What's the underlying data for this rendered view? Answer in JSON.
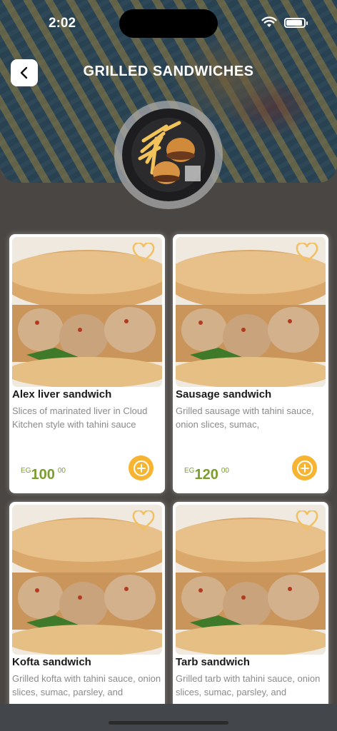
{
  "status_bar": {
    "time": "2:02"
  },
  "header": {
    "title": "GRILLED SANDWICHES"
  },
  "icons": {
    "back": "chevron-left-icon",
    "favorite": "heart-outline-icon",
    "add": "plus-circle-icon"
  },
  "colors": {
    "price": "#7a9e2c",
    "add_button": "#f6b431",
    "heart": "#f2c060",
    "background": "#4a4643"
  },
  "products": [
    {
      "name": "Alex liver sandwich",
      "description": "Slices of marinated liver in Cloud Kitchen style with tahini sauce",
      "currency": "EG",
      "price": "100",
      "price_decimal": "00"
    },
    {
      "name": "Sausage sandwich",
      "description": "Grilled sausage with tahini sauce, onion slices, sumac,",
      "currency": "EG",
      "price": "120",
      "price_decimal": "00"
    },
    {
      "name": "Kofta sandwich",
      "description": "Grilled kofta with tahini sauce, onion slices, sumac, parsley, and"
    },
    {
      "name": "Tarb sandwich",
      "description": "Grilled tarb with tahini sauce, onion slices, sumac, parsley, and"
    }
  ]
}
